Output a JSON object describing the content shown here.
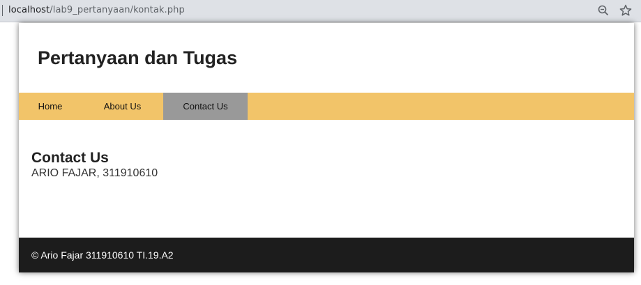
{
  "browser": {
    "url_host": "localhost",
    "url_path": "/lab9_pertanyaan/kontak.php",
    "zoom_icon": "zoom-icon",
    "bookmark_icon": "star-icon"
  },
  "header": {
    "title": "Pertanyaan dan Tugas"
  },
  "nav": {
    "items": [
      {
        "label": "Home",
        "active": false
      },
      {
        "label": "About Us",
        "active": false
      },
      {
        "label": "Contact Us",
        "active": true
      }
    ]
  },
  "main": {
    "heading": "Contact Us",
    "text": "ARIO FAJAR, 311910610"
  },
  "footer": {
    "copyright": "© Ario Fajar 311910610 TI.19.A2"
  },
  "colors": {
    "nav_bg": "#f2c469",
    "nav_active": "#999999",
    "footer_bg": "#1c1c1c"
  }
}
